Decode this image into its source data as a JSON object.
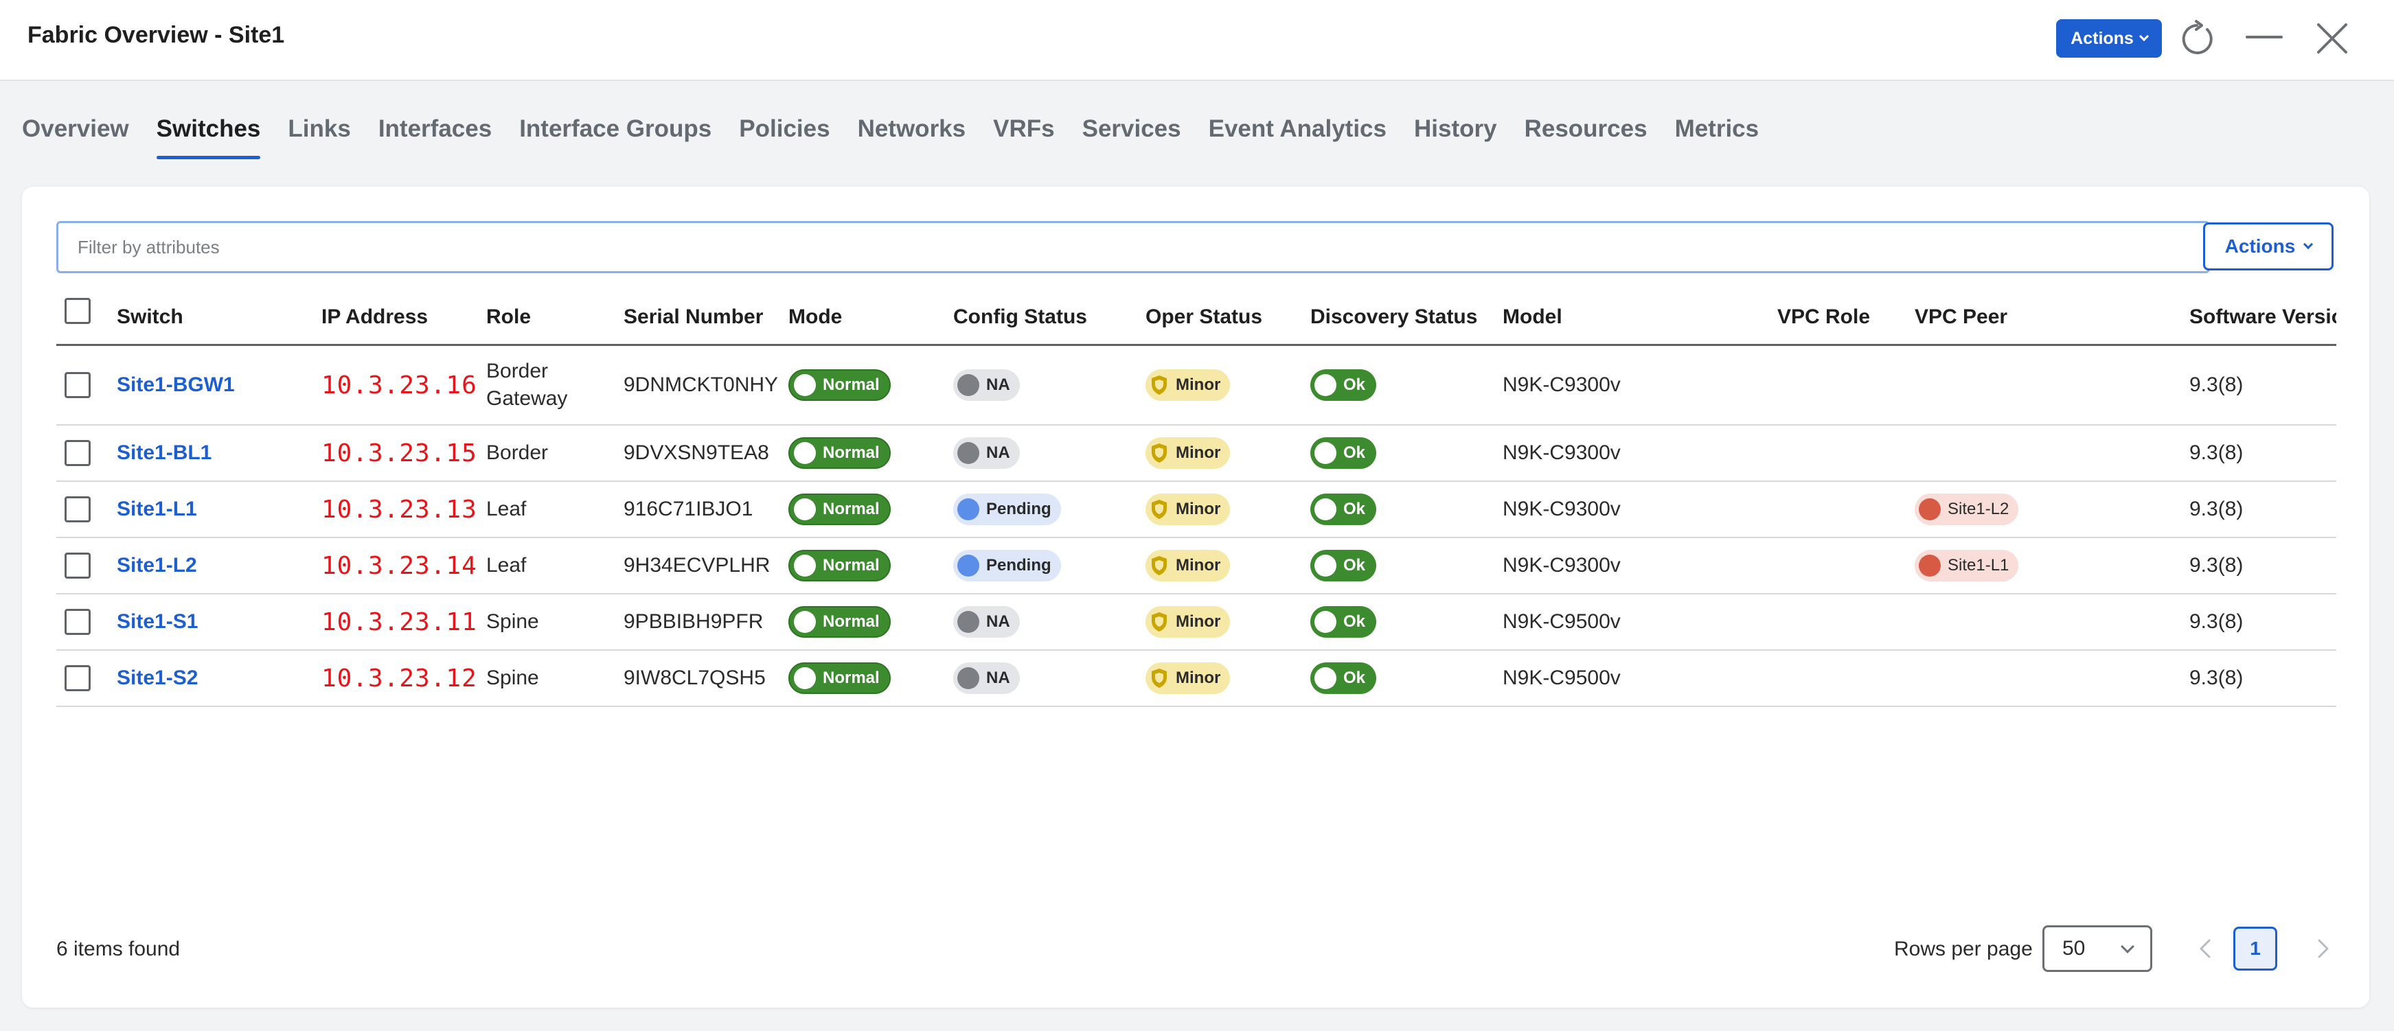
{
  "window": {
    "title": "Fabric Overview - Site1",
    "actions_label": "Actions"
  },
  "tabs": [
    {
      "label": "Overview",
      "active": false
    },
    {
      "label": "Switches",
      "active": true
    },
    {
      "label": "Links",
      "active": false
    },
    {
      "label": "Interfaces",
      "active": false
    },
    {
      "label": "Interface Groups",
      "active": false
    },
    {
      "label": "Policies",
      "active": false
    },
    {
      "label": "Networks",
      "active": false
    },
    {
      "label": "VRFs",
      "active": false
    },
    {
      "label": "Services",
      "active": false
    },
    {
      "label": "Event Analytics",
      "active": false
    },
    {
      "label": "History",
      "active": false
    },
    {
      "label": "Resources",
      "active": false
    },
    {
      "label": "Metrics",
      "active": false
    }
  ],
  "filter": {
    "placeholder": "Filter by attributes",
    "value": ""
  },
  "card_actions_label": "Actions",
  "table": {
    "headers": {
      "switch": "Switch",
      "ip": "IP Address",
      "role": "Role",
      "serial": "Serial Number",
      "mode": "Mode",
      "config": "Config Status",
      "oper": "Oper Status",
      "discovery": "Discovery Status",
      "model": "Model",
      "vpc_role": "VPC Role",
      "vpc_peer": "VPC Peer",
      "software": "Software Versio"
    },
    "rows": [
      {
        "switch": "Site1-BGW1",
        "ip": "10.3.23.16",
        "role": "Border Gateway",
        "serial": "9DNMCKT0NHY",
        "mode": "Normal",
        "config": "NA",
        "oper": "Minor",
        "discovery": "Ok",
        "model": "N9K-C9300v",
        "vpc_role": "",
        "vpc_peer": "",
        "software": "9.3(8)"
      },
      {
        "switch": "Site1-BL1",
        "ip": "10.3.23.15",
        "role": "Border",
        "serial": "9DVXSN9TEA8",
        "mode": "Normal",
        "config": "NA",
        "oper": "Minor",
        "discovery": "Ok",
        "model": "N9K-C9300v",
        "vpc_role": "",
        "vpc_peer": "",
        "software": "9.3(8)"
      },
      {
        "switch": "Site1-L1",
        "ip": "10.3.23.13",
        "role": "Leaf",
        "serial": "916C71IBJO1",
        "mode": "Normal",
        "config": "Pending",
        "oper": "Minor",
        "discovery": "Ok",
        "model": "N9K-C9300v",
        "vpc_role": "",
        "vpc_peer": "Site1-L2",
        "software": "9.3(8)"
      },
      {
        "switch": "Site1-L2",
        "ip": "10.3.23.14",
        "role": "Leaf",
        "serial": "9H34ECVPLHR",
        "mode": "Normal",
        "config": "Pending",
        "oper": "Minor",
        "discovery": "Ok",
        "model": "N9K-C9300v",
        "vpc_role": "",
        "vpc_peer": "Site1-L1",
        "software": "9.3(8)"
      },
      {
        "switch": "Site1-S1",
        "ip": "10.3.23.11",
        "role": "Spine",
        "serial": "9PBBIBH9PFR",
        "mode": "Normal",
        "config": "NA",
        "oper": "Minor",
        "discovery": "Ok",
        "model": "N9K-C9500v",
        "vpc_role": "",
        "vpc_peer": "",
        "software": "9.3(8)"
      },
      {
        "switch": "Site1-S2",
        "ip": "10.3.23.12",
        "role": "Spine",
        "serial": "9IW8CL7QSH5",
        "mode": "Normal",
        "config": "NA",
        "oper": "Minor",
        "discovery": "Ok",
        "model": "N9K-C9500v",
        "vpc_role": "",
        "vpc_peer": "",
        "software": "9.3(8)"
      }
    ]
  },
  "footer": {
    "items_found": "6 items found",
    "rows_per_page_label": "Rows per page",
    "rows_per_page_value": "50",
    "current_page": "1"
  },
  "icons": {
    "window": [
      "refresh-icon",
      "minimize-icon",
      "close-icon"
    ],
    "status": [
      "shield-icon",
      "status-dot-icon"
    ],
    "pagination": [
      "chevron-left-icon",
      "chevron-right-icon"
    ]
  },
  "colors": {
    "accent": "#1d5fd0",
    "ip_text": "#e8141a",
    "normal": "#3d8b2f",
    "minor": "#f6e8a6",
    "pending": "#5a8ee8",
    "vpc_peer": "#d75a45"
  }
}
